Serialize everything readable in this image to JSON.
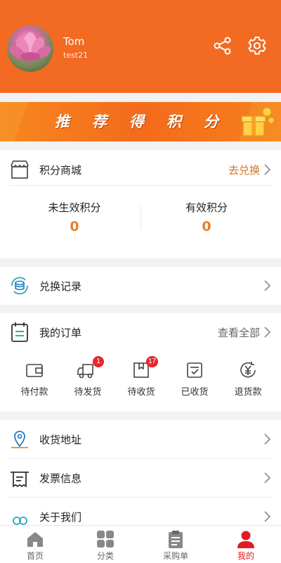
{
  "profile": {
    "name": "Tom",
    "user_id": "test21"
  },
  "banner": {
    "text": "推荐得积分"
  },
  "points_mall": {
    "title": "积分商城",
    "action": "去兑换",
    "pending_label": "未生效积分",
    "pending_value": "0",
    "valid_label": "有效积分",
    "valid_value": "0"
  },
  "exchange_record": {
    "label": "兑换记录"
  },
  "orders": {
    "title": "我的订单",
    "view_all": "查看全部",
    "items": [
      {
        "label": "待付款",
        "badge": ""
      },
      {
        "label": "待发货",
        "badge": "1"
      },
      {
        "label": "待收货",
        "badge": "17"
      },
      {
        "label": "已收货",
        "badge": ""
      },
      {
        "label": "退货款",
        "badge": ""
      }
    ]
  },
  "menu": {
    "address": "收货地址",
    "invoice": "发票信息",
    "about": "关于我们"
  },
  "tabbar": [
    {
      "label": "首页",
      "icon": "home-icon"
    },
    {
      "label": "分类",
      "icon": "category-icon"
    },
    {
      "label": "采购单",
      "icon": "clipboard-icon"
    },
    {
      "label": "我的",
      "icon": "user-icon"
    }
  ],
  "colors": {
    "brand": "#f36a22",
    "accent": "#e8812e",
    "active_tab": "#e11b22"
  }
}
